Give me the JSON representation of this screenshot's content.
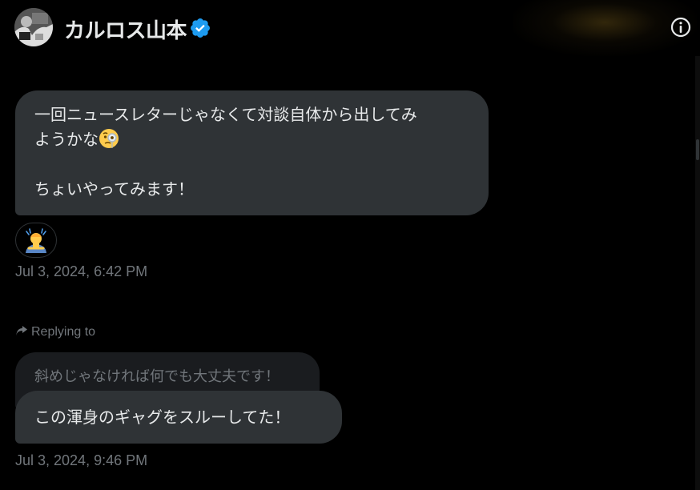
{
  "header": {
    "display_name": "カルロス山本",
    "verified_icon": "verified-badge-icon",
    "info_icon": "info-icon",
    "avatar_icon": "avatar"
  },
  "messages": [
    {
      "line1": "一回ニュースレターじゃなくて対談自体から出してみ",
      "line2": "ようかな",
      "line2_emoji": "face-with-monocle-emoji",
      "line3": "ちょいやってみます！",
      "reaction_emoji": "person-gesturing-frustrated-emoji",
      "timestamp": "Jul 3, 2024, 6:42 PM"
    },
    {
      "replying_to_label": "Replying to",
      "replying_icon": "reply-arrow-icon",
      "quoted_text": "斜めじゃなければ何でも大丈夫です！",
      "text": "この渾身のギャグをスルーしてた！",
      "timestamp": "Jul 3, 2024, 9:46 PM"
    }
  ],
  "colors": {
    "background": "#000000",
    "bubble": "#2f3336",
    "quoted_bubble": "#1a1c1f",
    "text": "#e7e9ea",
    "muted_text": "#71767b",
    "verified_blue": "#1d9bf0"
  }
}
